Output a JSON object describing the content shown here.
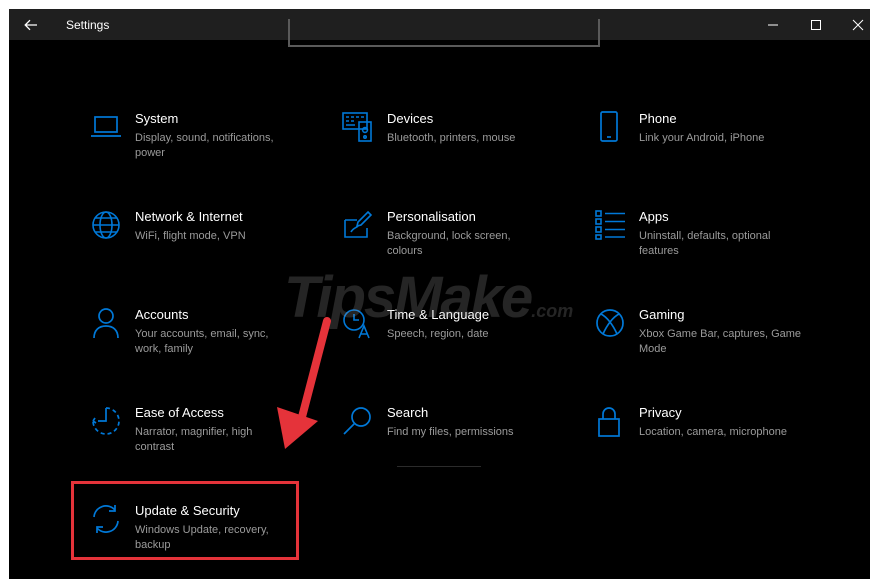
{
  "window": {
    "title": "Settings"
  },
  "colors": {
    "accent": "#0078d7",
    "highlight": "#e5333a",
    "background": "#000000"
  },
  "watermark": {
    "main": "TipsMake",
    "domain": ".com"
  },
  "tiles": [
    {
      "id": "system",
      "icon": "laptop-icon",
      "title": "System",
      "desc": "Display, sound, notifications, power"
    },
    {
      "id": "devices",
      "icon": "keyboard-icon",
      "title": "Devices",
      "desc": "Bluetooth, printers, mouse"
    },
    {
      "id": "phone",
      "icon": "phone-icon",
      "title": "Phone",
      "desc": "Link your Android, iPhone"
    },
    {
      "id": "network",
      "icon": "globe-icon",
      "title": "Network & Internet",
      "desc": "WiFi, flight mode, VPN"
    },
    {
      "id": "personalisation",
      "icon": "paintbrush-icon",
      "title": "Personalisation",
      "desc": "Background, lock screen, colours"
    },
    {
      "id": "apps",
      "icon": "apps-list-icon",
      "title": "Apps",
      "desc": "Uninstall, defaults, optional features"
    },
    {
      "id": "accounts",
      "icon": "person-icon",
      "title": "Accounts",
      "desc": "Your accounts, email, sync, work, family"
    },
    {
      "id": "time",
      "icon": "clock-language-icon",
      "title": "Time & Language",
      "desc": "Speech, region, date"
    },
    {
      "id": "gaming",
      "icon": "xbox-icon",
      "title": "Gaming",
      "desc": "Xbox Game Bar, captures, Game Mode"
    },
    {
      "id": "ease",
      "icon": "ease-of-access-icon",
      "title": "Ease of Access",
      "desc": "Narrator, magnifier, high contrast"
    },
    {
      "id": "search",
      "icon": "search-icon",
      "title": "Search",
      "desc": "Find my files, permissions"
    },
    {
      "id": "privacy",
      "icon": "lock-icon",
      "title": "Privacy",
      "desc": "Location, camera, microphone"
    },
    {
      "id": "update",
      "icon": "sync-icon",
      "title": "Update & Security",
      "desc": "Windows Update, recovery, backup"
    }
  ]
}
